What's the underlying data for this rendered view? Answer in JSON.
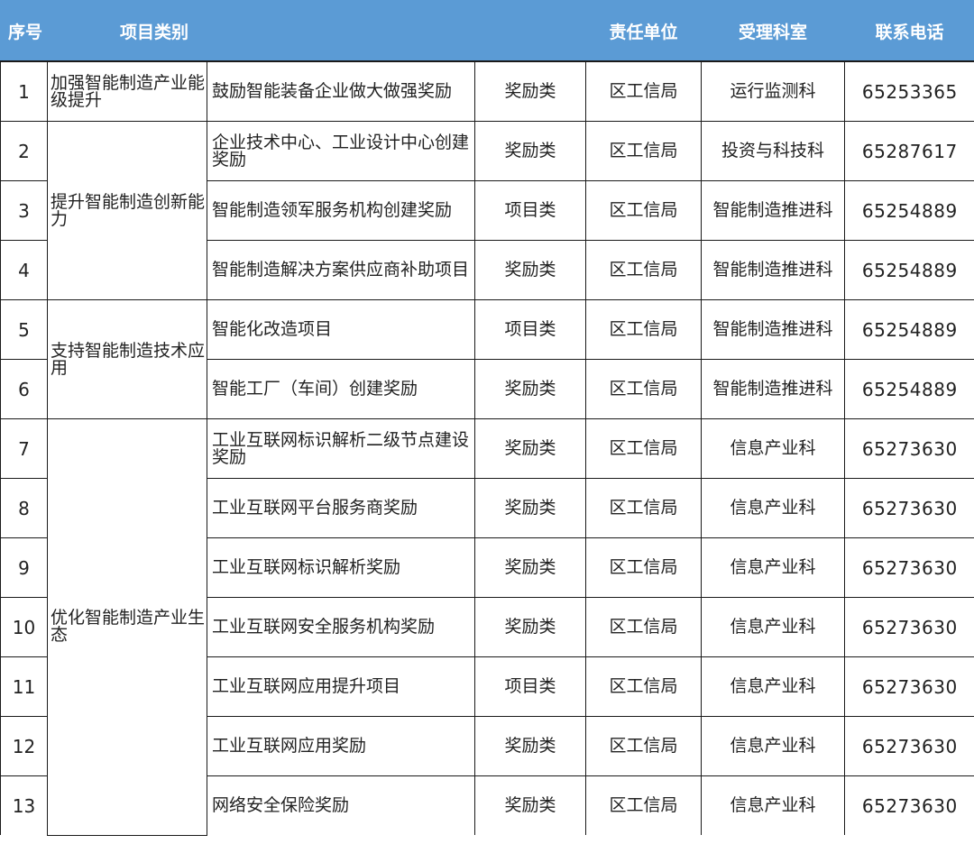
{
  "table": {
    "headers": {
      "no": "序号",
      "category": "项目类别",
      "unit": "责任单位",
      "dept": "受理科室",
      "phone": "联系电话"
    },
    "categories": [
      "加强智能制造产业能级提升",
      "提升智能制造创新能力",
      "支持智能制造技术应用",
      "优化智能制造产业生态"
    ],
    "rows": [
      {
        "no": "1",
        "item": "鼓励智能装备企业做大做强奖励",
        "type": "奖励类",
        "unit": "区工信局",
        "dept": "运行监测科",
        "phone": "65253365"
      },
      {
        "no": "2",
        "item": "企业技术中心、工业设计中心创建奖励",
        "type": "奖励类",
        "unit": "区工信局",
        "dept": "投资与科技科",
        "phone": "65287617"
      },
      {
        "no": "3",
        "item": "智能制造领军服务机构创建奖励",
        "type": "项目类",
        "unit": "区工信局",
        "dept": "智能制造推进科",
        "phone": "65254889"
      },
      {
        "no": "4",
        "item": "智能制造解决方案供应商补助项目",
        "type": "奖励类",
        "unit": "区工信局",
        "dept": "智能制造推进科",
        "phone": "65254889"
      },
      {
        "no": "5",
        "item": "智能化改造项目",
        "type": "项目类",
        "unit": "区工信局",
        "dept": "智能制造推进科",
        "phone": "65254889"
      },
      {
        "no": "6",
        "item": "智能工厂（车间）创建奖励",
        "type": "奖励类",
        "unit": "区工信局",
        "dept": "智能制造推进科",
        "phone": "65254889"
      },
      {
        "no": "7",
        "item": "工业互联网标识解析二级节点建设奖励",
        "type": "奖励类",
        "unit": "区工信局",
        "dept": "信息产业科",
        "phone": "65273630"
      },
      {
        "no": "8",
        "item": "工业互联网平台服务商奖励",
        "type": "奖励类",
        "unit": "区工信局",
        "dept": "信息产业科",
        "phone": "65273630"
      },
      {
        "no": "9",
        "item": "工业互联网标识解析奖励",
        "type": "奖励类",
        "unit": "区工信局",
        "dept": "信息产业科",
        "phone": "65273630"
      },
      {
        "no": "10",
        "item": "工业互联网安全服务机构奖励",
        "type": "奖励类",
        "unit": "区工信局",
        "dept": "信息产业科",
        "phone": "65273630"
      },
      {
        "no": "11",
        "item": "工业互联网应用提升项目",
        "type": "项目类",
        "unit": "区工信局",
        "dept": "信息产业科",
        "phone": "65273630"
      },
      {
        "no": "12",
        "item": "工业互联网应用奖励",
        "type": "奖励类",
        "unit": "区工信局",
        "dept": "信息产业科",
        "phone": "65273630"
      },
      {
        "no": "13",
        "item": "网络安全保险奖励",
        "type": "奖励类",
        "unit": "区工信局",
        "dept": "信息产业科",
        "phone": "65273630"
      }
    ]
  },
  "colors": {
    "header_bg": "#5b9bd5",
    "header_text": "#ffffff",
    "grid_line": "#1a1a1a",
    "body_text": "#222222"
  }
}
